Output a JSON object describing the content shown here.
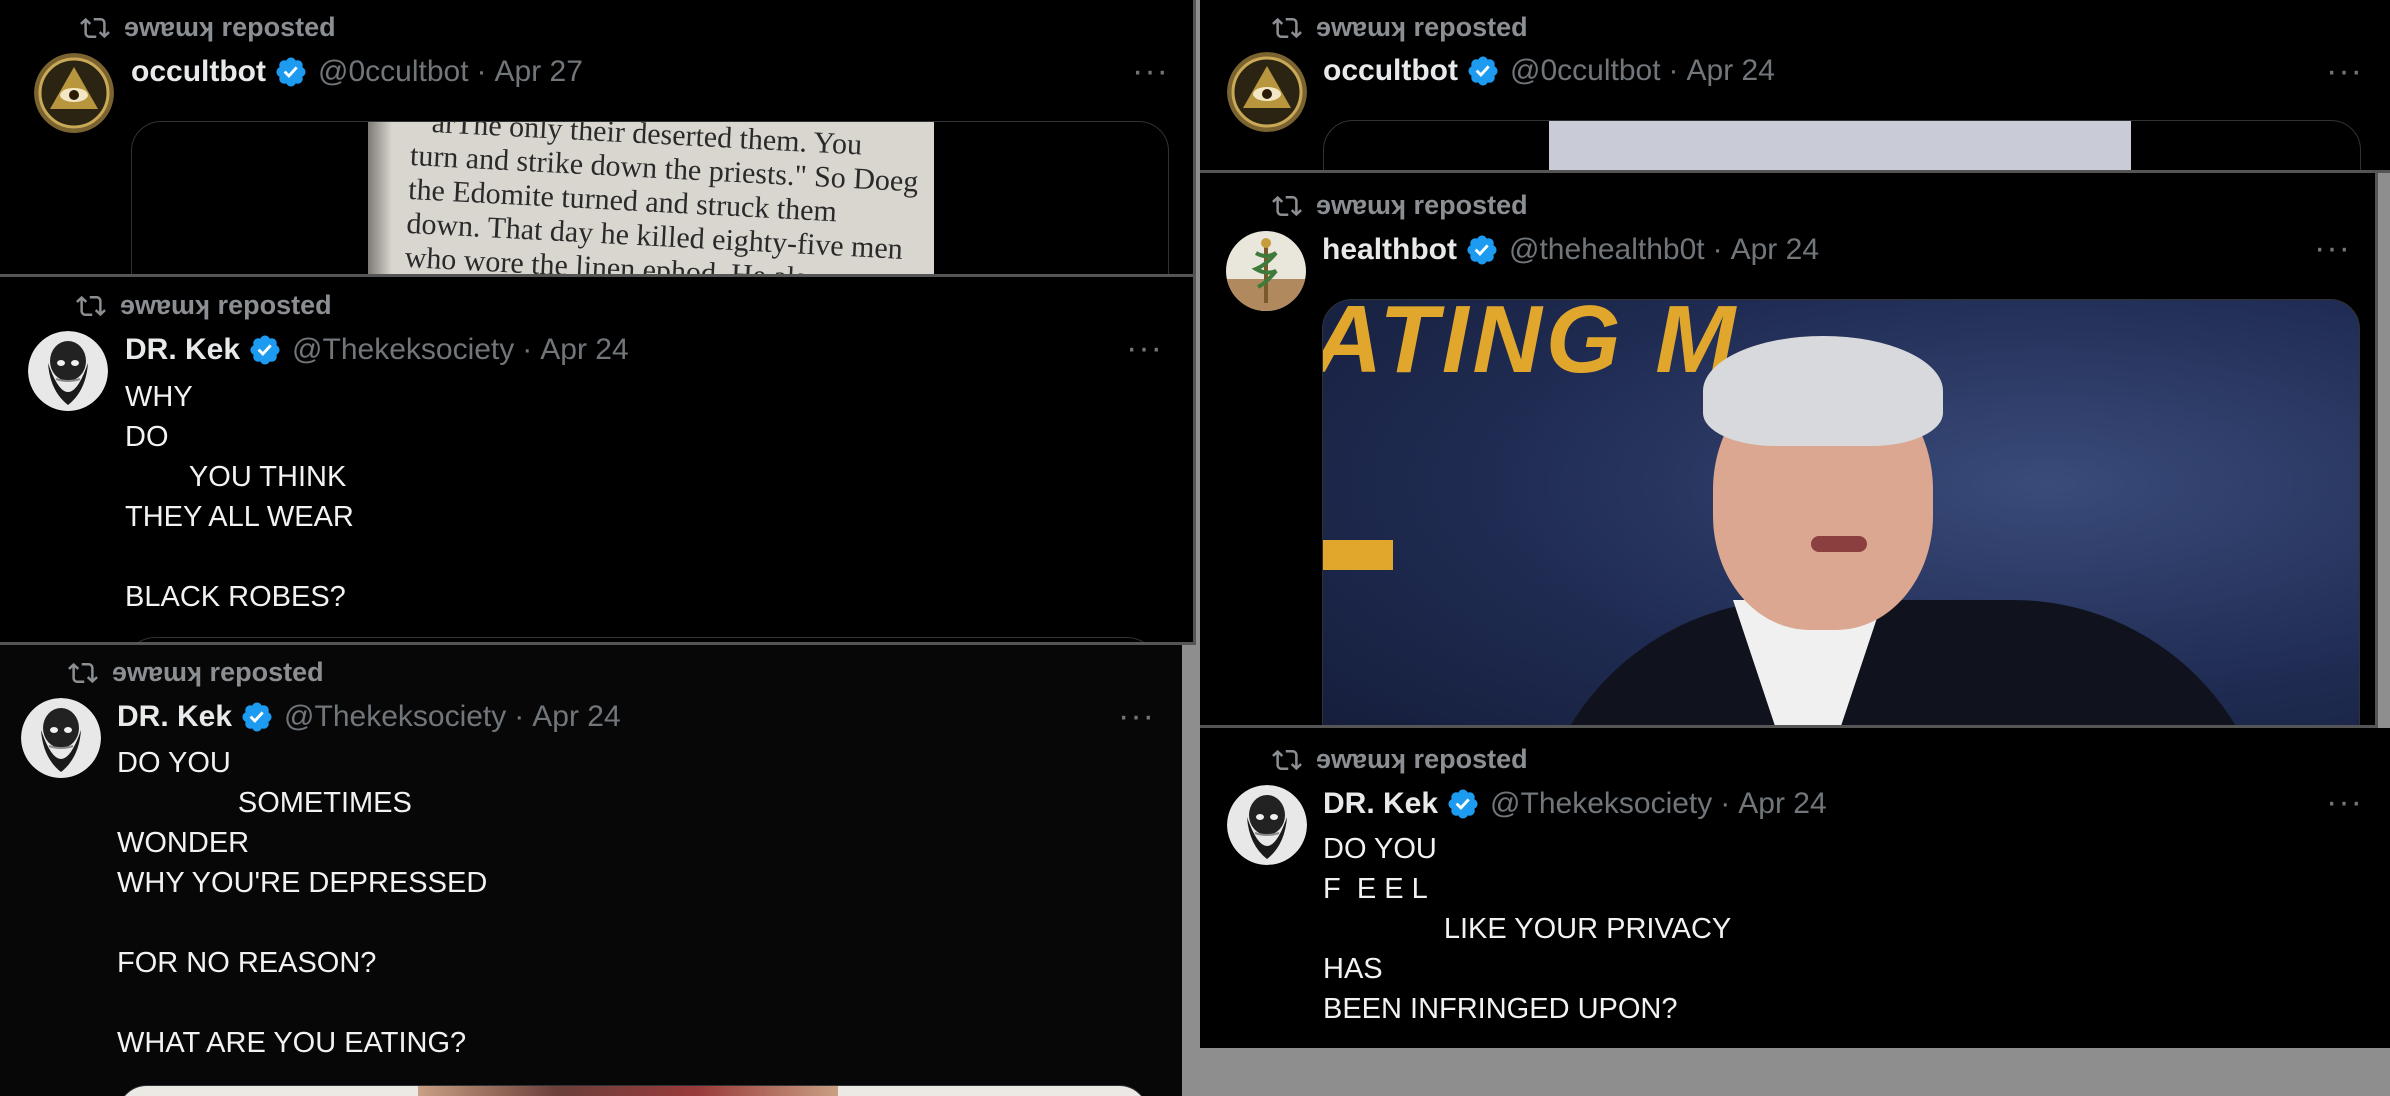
{
  "reposter_line": "ɘwɐɯʞ reposted",
  "posts": [
    {
      "author": "occultbot",
      "handle": "@0ccultbot",
      "sep": "·",
      "date": "Apr 27",
      "avatar_icon": "eye-pyramid-icon",
      "image_text_lines": [
        "arThe only their deserted them. You",
        "turn and strike down the priests.\" So Doeg",
        "the Edomite turned and struck them",
        "down. That day he killed eighty-five men",
        "who wore the linen ephod. He also"
      ]
    },
    {
      "author": "DR. Kek",
      "handle": "@Thekeksociety",
      "sep": "·",
      "date": "Apr 24",
      "avatar_icon": "bearded-man-icon",
      "text": "WHY\nDO\n        YOU THINK\nTHEY ALL WEAR\n\nBLACK ROBES?"
    },
    {
      "author": "DR. Kek",
      "handle": "@Thekeksociety",
      "sep": "·",
      "date": "Apr 24",
      "avatar_icon": "bearded-man-icon",
      "text": "DO YOU\n               SOMETIMES\nWONDER\nWHY YOU'RE DEPRESSED\n\nFOR NO REASON?\n\nWHAT ARE YOU EATING?"
    },
    {
      "author": "occultbot",
      "handle": "@0ccultbot",
      "sep": "·",
      "date": "Apr 24",
      "avatar_icon": "eye-pyramid-icon"
    },
    {
      "author": "healthbot",
      "handle": "@thehealthb0t",
      "sep": "·",
      "date": "Apr 24",
      "avatar_icon": "caduceus-icon",
      "image_text": "ATING M"
    },
    {
      "author": "DR. Kek",
      "handle": "@Thekeksociety",
      "sep": "·",
      "date": "Apr 24",
      "avatar_icon": "bearded-man-icon",
      "text": "DO YOU\nF  E E L\n               LIKE YOUR PRIVACY\nHAS\nBEEN INFRINGED UPON?"
    }
  ],
  "more_label": "···",
  "colors": {
    "background": "#000000",
    "verified": "#1d9bf0",
    "muted": "#71767b",
    "gray_frame": "#8e8e8e"
  }
}
